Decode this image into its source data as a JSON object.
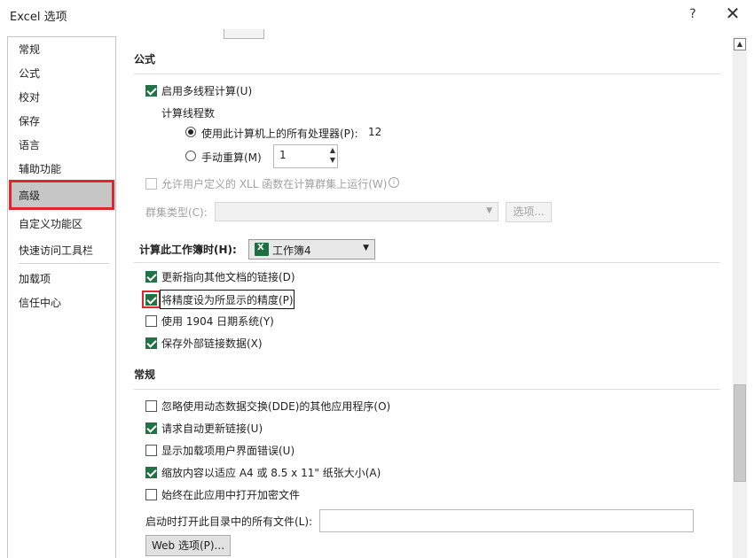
{
  "window": {
    "title": "Excel 选项",
    "help": "?",
    "close": "✕"
  },
  "sidebar": {
    "items": [
      "常规",
      "公式",
      "校对",
      "保存",
      "语言",
      "辅助功能",
      "高级",
      "自定义功能区",
      "快速访问工具栏",
      "加载项",
      "信任中心"
    ],
    "selected": "高级"
  },
  "formulas": {
    "title": "公式",
    "multithread": {
      "label": "启用多线程计算(U)",
      "checked": true
    },
    "thread_count_label": "计算线程数",
    "use_all": {
      "label": "使用此计算机上的所有处理器(P):",
      "value": "12"
    },
    "manual": {
      "label": "手动重算(M)",
      "value": "1"
    },
    "xll": {
      "label": "允许用户定义的 XLL 函数在计算群集上运行(W)",
      "checked": false
    },
    "cluster_type_label": "群集类型(C):",
    "options_button": "选项..."
  },
  "workbook_calc": {
    "label": "计算此工作簿时(H):",
    "workbook": "工作簿4",
    "options": [
      {
        "label": "更新指向其他文档的链接(D)",
        "checked": true
      },
      {
        "label": "将精度设为所显示的精度(P)",
        "checked": true
      },
      {
        "label": "使用 1904 日期系统(Y)",
        "checked": false
      },
      {
        "label": "保存外部链接数据(X)",
        "checked": true
      }
    ]
  },
  "general": {
    "title": "常规",
    "options": [
      {
        "label": "忽略使用动态数据交换(DDE)的其他应用程序(O)",
        "checked": false
      },
      {
        "label": "请求自动更新链接(U)",
        "checked": true
      },
      {
        "label": "显示加载项用户界面错误(U)",
        "checked": false
      },
      {
        "label": "缩放内容以适应 A4 或 8.5 x 11\" 纸张大小(A)",
        "checked": true
      },
      {
        "label": "始终在此应用中打开加密文件",
        "checked": false
      }
    ],
    "startup_label": "启动时打开此目录中的所有文件(L):",
    "startup_value": "",
    "web_options_button": "Web 选项(P)..."
  },
  "colors": {
    "accent_green": "#217346",
    "highlight_red": "#e0262c",
    "sidebar_selected": "#c6c6c6"
  }
}
